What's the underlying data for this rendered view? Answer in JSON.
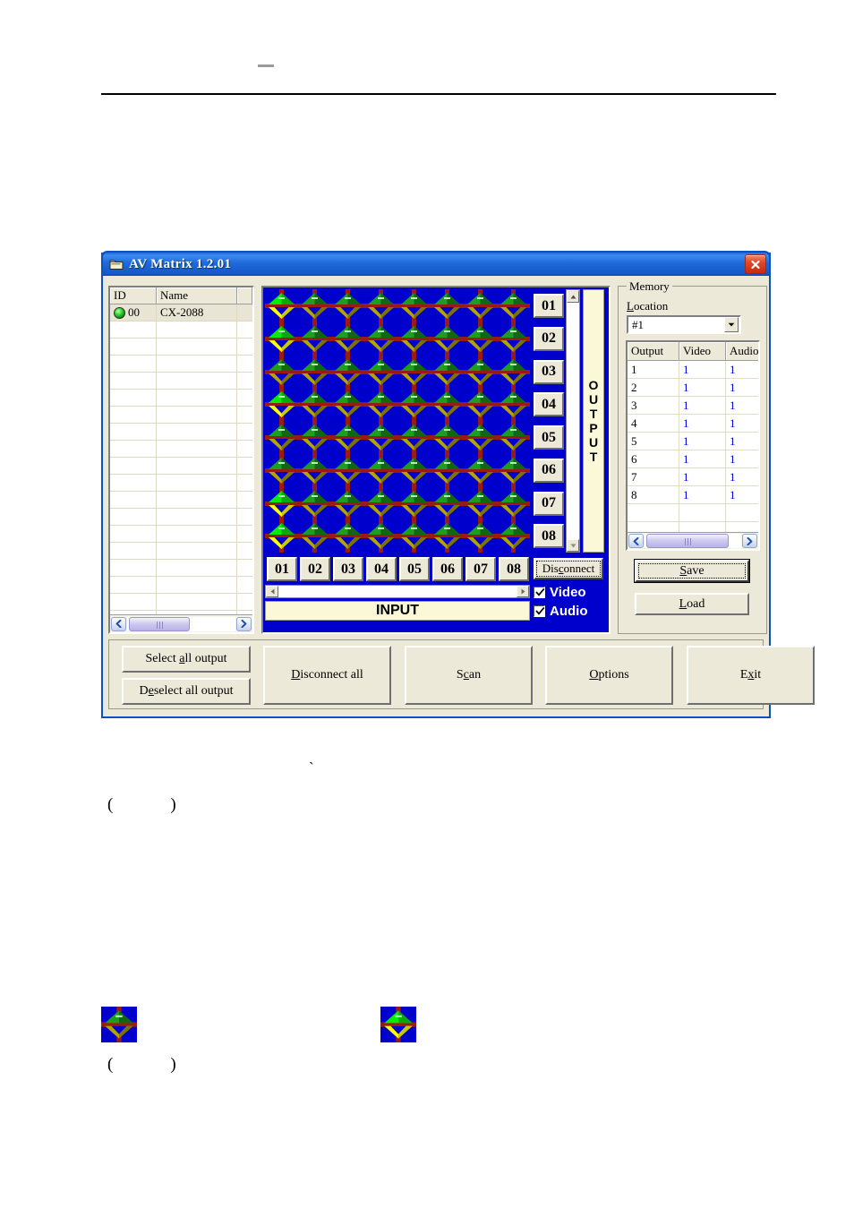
{
  "window": {
    "title": "AV Matrix 1.2.01",
    "icon": "document-folder-icon",
    "close_label": "×",
    "accent_titlebar": "#1557c8",
    "accent_close": "#c62a0c"
  },
  "device_list": {
    "columns": [
      "ID",
      "Name"
    ],
    "rows": [
      {
        "id": "00",
        "name": "CX-2088",
        "status": "online",
        "selected": true
      }
    ],
    "empty_row_count": 19,
    "scroll": {
      "left_arrow": "❮",
      "right_arrow": "❯"
    }
  },
  "matrix": {
    "background": "#0000cc",
    "size": {
      "inputs": 8,
      "outputs": 8
    },
    "output_buttons": [
      "01",
      "02",
      "03",
      "04",
      "05",
      "06",
      "07",
      "08"
    ],
    "input_buttons": [
      "01",
      "02",
      "03",
      "04",
      "05",
      "06",
      "07",
      "08"
    ],
    "output_label": "OUTPUT",
    "input_label": "INPUT",
    "label_background": "#fbf8d8",
    "active_cells": [
      {
        "output": 1,
        "input": 1
      },
      {
        "output": 2,
        "input": 1
      },
      {
        "output": 4,
        "input": 1
      },
      {
        "output": 7,
        "input": 1
      },
      {
        "output": 8,
        "input": 1
      }
    ],
    "colors": {
      "video_active": "#00ee00",
      "video_idle": "#1e9e1e",
      "audio_active": "#ffff00",
      "audio_idle": "#b5a400",
      "link": "#9a1a16"
    },
    "disconnect_label": "Disconnect",
    "disconnect_accel": "c",
    "checkboxes": [
      {
        "label": "Video",
        "checked": true
      },
      {
        "label": "Audio",
        "checked": true
      }
    ],
    "scroll": {
      "v_up": "▲",
      "v_down": "▼",
      "h_left": "◀",
      "h_right": "▶"
    }
  },
  "memory": {
    "group_label": "Memory",
    "location_label": "Location",
    "location_accel": "L",
    "location_value": "#1",
    "dropdown_arrow": "▼",
    "table": {
      "columns": [
        "Output",
        "Video",
        "Audio"
      ],
      "rows": [
        {
          "output": "1",
          "video": "1",
          "audio": "1"
        },
        {
          "output": "2",
          "video": "1",
          "audio": "1"
        },
        {
          "output": "3",
          "video": "1",
          "audio": "1"
        },
        {
          "output": "4",
          "video": "1",
          "audio": "1"
        },
        {
          "output": "5",
          "video": "1",
          "audio": "1"
        },
        {
          "output": "6",
          "video": "1",
          "audio": "1"
        },
        {
          "output": "7",
          "video": "1",
          "audio": "1"
        },
        {
          "output": "8",
          "video": "1",
          "audio": "1"
        }
      ],
      "empty_row_count": 5,
      "value_color": "#0000cc"
    },
    "save_label": "Save",
    "save_accel": "S",
    "save_focused": true,
    "load_label": "Load",
    "load_accel": "L",
    "scroll": {
      "left_arrow": "❮",
      "right_arrow": "❯"
    }
  },
  "toolbar": {
    "select_all_output": {
      "pre": "Select ",
      "accel": "a",
      "post": "ll output"
    },
    "deselect_all_output": {
      "pre": "D",
      "accel": "e",
      "post": "select all output"
    },
    "disconnect_all": {
      "pre": "",
      "accel": "D",
      "post": "isconnect all"
    },
    "scan": {
      "pre": "S",
      "accel": "c",
      "post": "an"
    },
    "options": {
      "pre": "",
      "accel": "O",
      "post": "ptions"
    },
    "exit": {
      "pre": "E",
      "accel": "x",
      "post": "it"
    }
  },
  "document": {
    "paren_1": "(    )",
    "paren_2": "(    )",
    "tick_mark": "ˋ",
    "legend_icon_inactive": "crosspoint-idle-icon",
    "legend_icon_active": "crosspoint-active-icon"
  }
}
